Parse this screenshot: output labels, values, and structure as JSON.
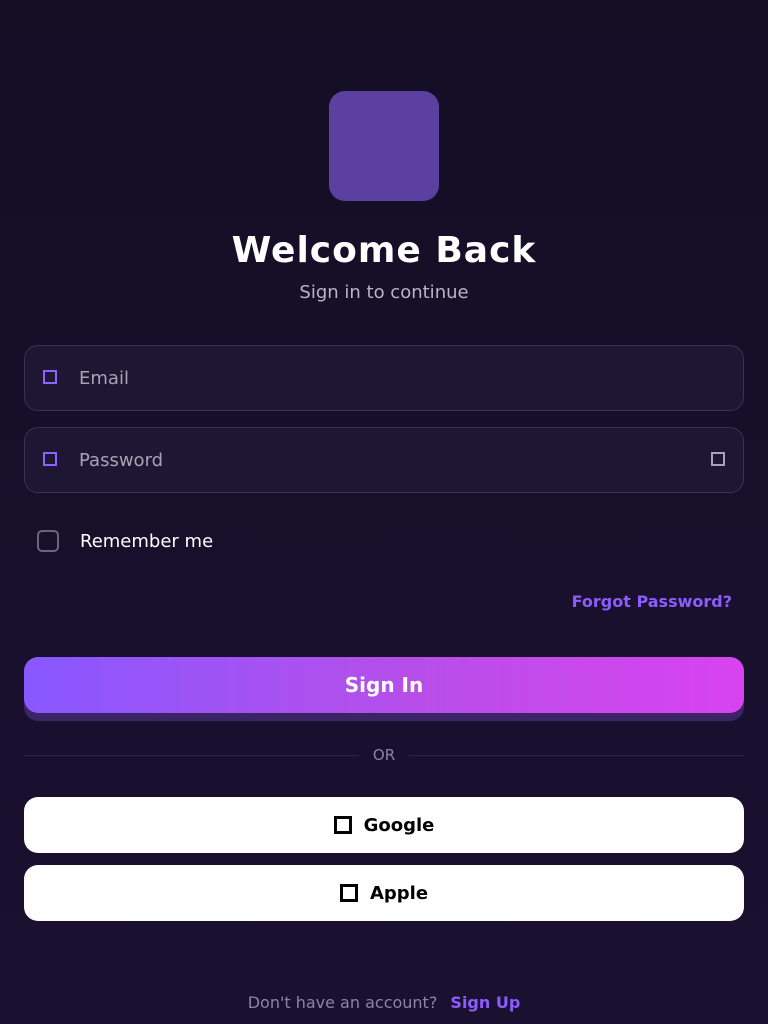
{
  "header": {
    "title": "Welcome Back",
    "subtitle": "Sign in to continue"
  },
  "form": {
    "email": {
      "placeholder": "Email",
      "icon": "mail-icon"
    },
    "password": {
      "placeholder": "Password",
      "icon": "lock-icon",
      "toggle_icon": "eye-icon"
    },
    "remember_label": "Remember me",
    "forgot_label": "Forgot Password?",
    "submit_label": "Sign In"
  },
  "divider": {
    "label": "OR"
  },
  "social": {
    "google_label": "Google",
    "apple_label": "Apple"
  },
  "footer": {
    "text": "Don't have an account?",
    "link": "Sign Up"
  },
  "colors": {
    "background": "#150f27",
    "accent": "#8d5cff",
    "button_gradient_start": "#8858ff",
    "button_gradient_end": "#d843ef",
    "logo": "#5b3fa1"
  }
}
